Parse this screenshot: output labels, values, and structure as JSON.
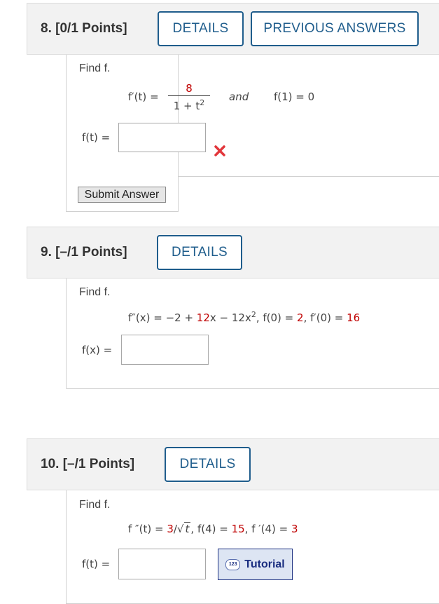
{
  "q8": {
    "number": "8.",
    "points": "[0/1 Points]",
    "details_label": "DETAILS",
    "previous_label": "PREVIOUS ANSWERS",
    "find": "Find f.",
    "fprime": "f′(t)",
    "eq": "=",
    "numerator": "8",
    "denominator": "1 + t",
    "den_exp": "2",
    "and": "and",
    "cond": "f(1) = 0",
    "answer_label": "f(t) =",
    "answer_value": "",
    "submit_label": "Submit Answer",
    "wrong_icon": "x-mark-icon"
  },
  "q9": {
    "number": "9.",
    "points": "[–/1 Points]",
    "details_label": "DETAILS",
    "find": "Find f.",
    "eq_lhs": "f″(x) = −2 + ",
    "coef1": "12",
    "x1": "x − 12x",
    "x_exp": "2",
    "c1_lhs": ",   f(0) = ",
    "c1_val": "2",
    "c2_lhs": ",   f′(0) = ",
    "c2_val": "16",
    "answer_label": "f(x) =",
    "answer_value": ""
  },
  "q10": {
    "number": "10.",
    "points": "[–/1 Points]",
    "details_label": "DETAILS",
    "find": "Find f.",
    "eq_lhs": "f ″(t) = ",
    "coef": "3",
    "slash": "/",
    "radicand": "t",
    "c1_lhs": ",   f(4) = ",
    "c1_val": "15",
    "c2_lhs": ",   f ′(4) = ",
    "c2_val": "3",
    "answer_label": "f(t) =",
    "answer_value": "",
    "tutorial_label": "Tutorial",
    "tutorial_icon_text": "123"
  },
  "colors": {
    "link": "#1f5d8c",
    "red": "#c00000",
    "tutorial": "#1a2e80"
  }
}
